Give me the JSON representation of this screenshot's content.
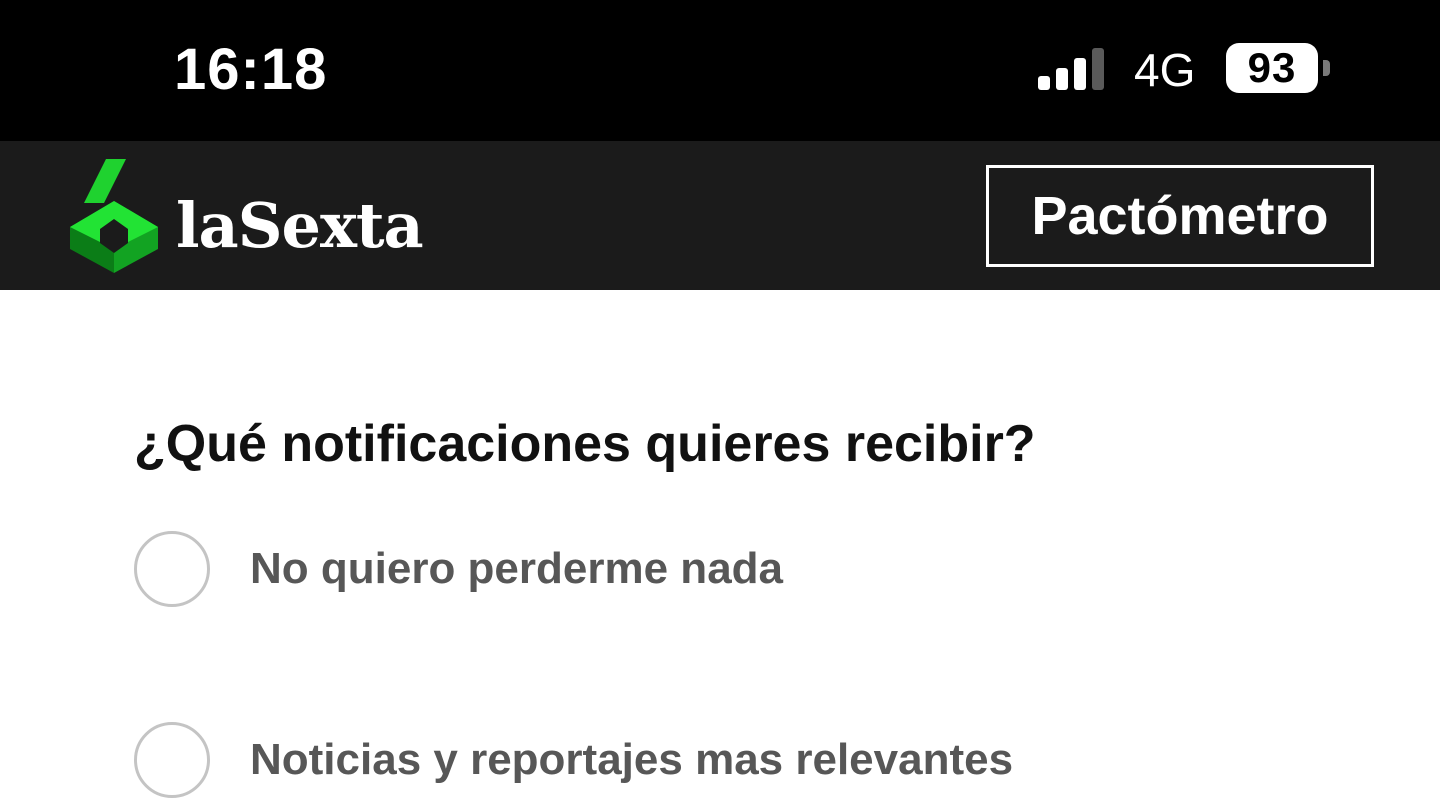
{
  "status_bar": {
    "time": "16:18",
    "network": "4G",
    "battery": "93",
    "icons": [
      "signal-icon",
      "battery-icon"
    ]
  },
  "header": {
    "brand": "laSexta",
    "logo_icon": "lasexta-logo-icon",
    "button_label": "Pactómetro",
    "colors": {
      "header_bg": "#1b1b1b",
      "logo_green": "#19c52b",
      "logo_dark_green": "#0d8a1a"
    }
  },
  "form": {
    "question": "¿Qué notificaciones quieres recibir?",
    "options": [
      {
        "label": "No quiero perderme nada",
        "selected": false
      },
      {
        "label": "Noticias y reportajes mas relevantes",
        "selected": false
      }
    ]
  }
}
